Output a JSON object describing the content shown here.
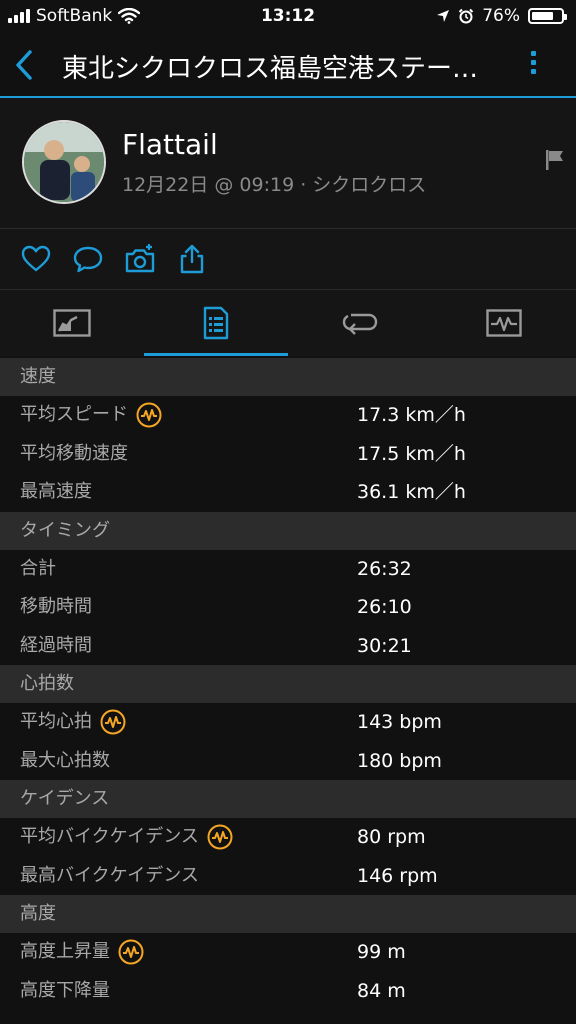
{
  "status_bar": {
    "carrier": "SoftBank",
    "time": "13:12",
    "battery": "76%",
    "battery_level": 0.76
  },
  "nav": {
    "title": "東北シクロクロス福島空港ステー…"
  },
  "profile": {
    "name": "Flattail",
    "meta": "12月22日 @ 09:19 · シクロクロス"
  },
  "colors": {
    "accent": "#1e9cd7",
    "badge": "#f5a623",
    "background": "#111111",
    "section_header": "#2c2c2c"
  },
  "tabs": [
    {
      "icon": "chart-summary-icon",
      "active": false
    },
    {
      "icon": "stats-list-icon",
      "active": true
    },
    {
      "icon": "laps-icon",
      "active": false
    },
    {
      "icon": "graph-icon",
      "active": false
    }
  ],
  "sections": [
    {
      "title": "速度",
      "rows": [
        {
          "label": "平均スピード",
          "value": "17.3 km／h",
          "badge": true
        },
        {
          "label": "平均移動速度",
          "value": "17.5 km／h",
          "badge": false
        },
        {
          "label": "最高速度",
          "value": "36.1 km／h",
          "badge": false
        }
      ]
    },
    {
      "title": "タイミング",
      "rows": [
        {
          "label": "合計",
          "value": "26:32",
          "badge": false
        },
        {
          "label": "移動時間",
          "value": "26:10",
          "badge": false
        },
        {
          "label": "経過時間",
          "value": "30:21",
          "badge": false
        }
      ]
    },
    {
      "title": "心拍数",
      "rows": [
        {
          "label": "平均心拍",
          "value": "143 bpm",
          "badge": true
        },
        {
          "label": "最大心拍数",
          "value": "180 bpm",
          "badge": false
        }
      ]
    },
    {
      "title": "ケイデンス",
      "rows": [
        {
          "label": "平均バイクケイデンス",
          "value": "80 rpm",
          "badge": true
        },
        {
          "label": "最高バイクケイデンス",
          "value": "146 rpm",
          "badge": false
        }
      ]
    },
    {
      "title": "高度",
      "rows": [
        {
          "label": "高度上昇量",
          "value": "99 m",
          "badge": true
        },
        {
          "label": "高度下降量",
          "value": "84 m",
          "badge": false
        }
      ]
    }
  ]
}
